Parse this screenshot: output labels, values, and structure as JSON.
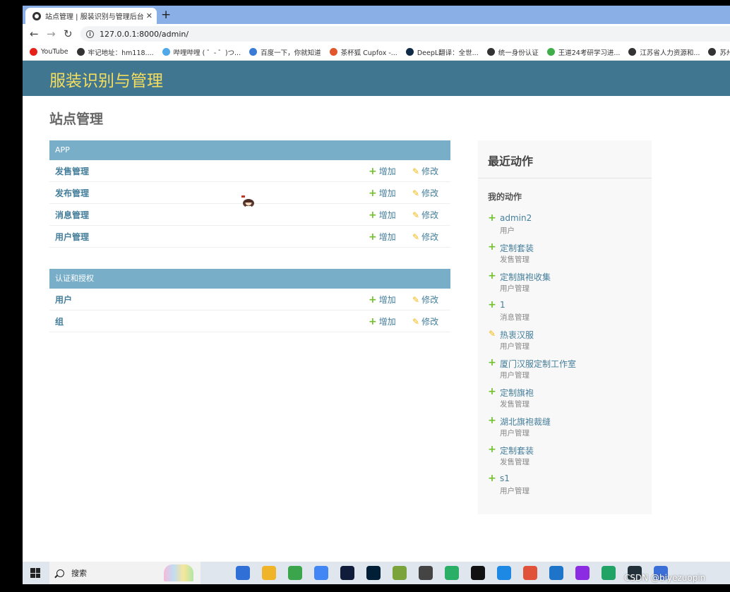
{
  "browser": {
    "tab_title": "站点管理 | 服装识别与管理后台",
    "tab_close": "✕",
    "new_tab": "+",
    "url": "127.0.0.1:8000/admin/",
    "bookmarks": [
      {
        "label": "YouTube",
        "color": "#e62117"
      },
      {
        "label": "牢记地址：hm118....",
        "color": "#333333"
      },
      {
        "label": "哔哩哔哩 ( ゜- ゜)つ...",
        "color": "#4fa9e8"
      },
      {
        "label": "百度一下，你就知道",
        "color": "#3a7bd5"
      },
      {
        "label": "茶杯狐 Cupfox -...",
        "color": "#e2562e"
      },
      {
        "label": "DeepL翻译：全世...",
        "color": "#0f2b46"
      },
      {
        "label": "统一身份认证",
        "color": "#333333"
      },
      {
        "label": "王道24考研学习进...",
        "color": "#3fae49"
      },
      {
        "label": "江苏省人力资源和...",
        "color": "#333333"
      },
      {
        "label": "苏州市人力",
        "color": "#333333"
      }
    ]
  },
  "header": {
    "brand": "服装识别与管理"
  },
  "page_title": "站点管理",
  "modules": [
    {
      "caption": "APP",
      "rows": [
        {
          "name": "发售管理",
          "add": "增加",
          "change": "修改"
        },
        {
          "name": "发布管理",
          "add": "增加",
          "change": "修改"
        },
        {
          "name": "消息管理",
          "add": "增加",
          "change": "修改"
        },
        {
          "name": "用户管理",
          "add": "增加",
          "change": "修改"
        }
      ]
    },
    {
      "caption": "认证和授权",
      "rows": [
        {
          "name": "用户",
          "add": "增加",
          "change": "修改"
        },
        {
          "name": "组",
          "add": "增加",
          "change": "修改"
        }
      ]
    }
  ],
  "recent": {
    "title": "最近动作",
    "subtitle": "我的动作",
    "actions": [
      {
        "kind": "add",
        "name": "admin2",
        "type": "用户"
      },
      {
        "kind": "add",
        "name": "定制套装",
        "type": "发售管理"
      },
      {
        "kind": "add",
        "name": "定制旗袍收集",
        "type": "用户管理"
      },
      {
        "kind": "add",
        "name": "1",
        "type": "消息管理"
      },
      {
        "kind": "change",
        "name": "热衷汉服",
        "type": "用户管理"
      },
      {
        "kind": "add",
        "name": "厦门汉服定制工作室",
        "type": "用户管理"
      },
      {
        "kind": "add",
        "name": "定制旗袍",
        "type": "发售管理"
      },
      {
        "kind": "add",
        "name": "湖北旗袍裁缝",
        "type": "用户管理"
      },
      {
        "kind": "add",
        "name": "定制套装",
        "type": "发售管理"
      },
      {
        "kind": "add",
        "name": "s1",
        "type": "用户管理"
      }
    ]
  },
  "taskbar": {
    "search_label": "搜索",
    "apps": [
      "#2f6fd6",
      "#f0b429",
      "#3aa54a",
      "#4285f4",
      "#0f1d3a",
      "#001e36",
      "#7aa33c",
      "#444444",
      "#2bae66",
      "#111111",
      "#1e88e5",
      "#e0533a",
      "#1e74c8",
      "#8b2be2",
      "#21a366",
      "#22303a",
      "#3b6fd8"
    ]
  },
  "watermark": "CSDN @biyezuopin"
}
